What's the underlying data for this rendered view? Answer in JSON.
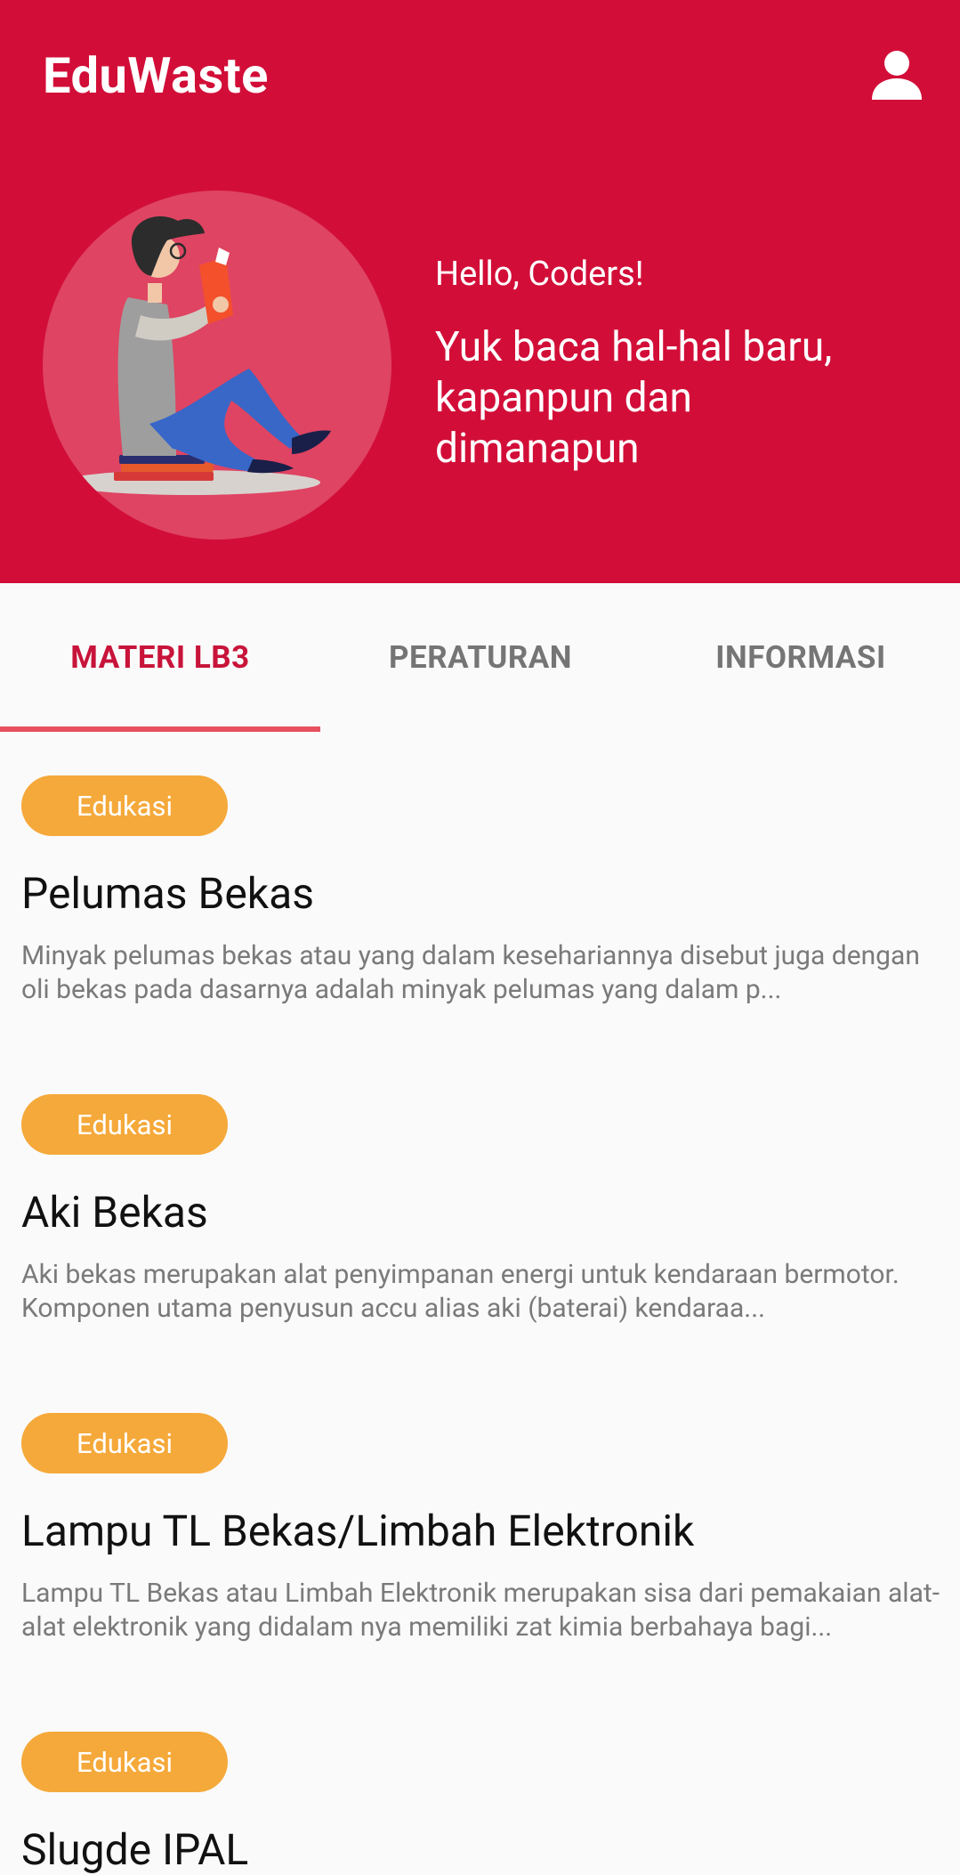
{
  "app": {
    "title": "EduWaste"
  },
  "hero": {
    "greeting": "Hello, Coders!",
    "tagline": "Yuk baca hal-hal baru, kapanpun dan dimanapun"
  },
  "tabs": [
    {
      "label": "MATERI LB3",
      "active": true
    },
    {
      "label": "PERATURAN",
      "active": false
    },
    {
      "label": "INFORMASI",
      "active": false
    }
  ],
  "articles": [
    {
      "badge": "Edukasi",
      "title": "Pelumas Bekas",
      "desc": "Minyak pelumas bekas atau yang dalam kesehariannya disebut juga dengan oli bekas pada dasarnya adalah minyak pelumas yang dalam p..."
    },
    {
      "badge": "Edukasi",
      "title": "Aki Bekas",
      "desc": "Aki bekas merupakan alat penyimpanan energi untuk kendaraan bermotor. Komponen utama penyusun accu alias aki (baterai) kendaraa..."
    },
    {
      "badge": "Edukasi",
      "title": "Lampu TL Bekas/Limbah Elektronik",
      "desc": "Lampu TL Bekas atau Limbah Elektronik merupakan sisa dari pemakaian alat-alat elektronik yang didalam nya memiliki zat kimia berbahaya bagi..."
    },
    {
      "badge": "Edukasi",
      "title": "Slugde IPAL",
      "desc": ""
    }
  ],
  "colors": {
    "primary": "#d20e38",
    "badge": "#f5a93a",
    "tab_active": "#c8143a",
    "indicator": "#e8505f"
  },
  "icons": {
    "profile": "person-icon",
    "hero": "reading-person-illustration"
  }
}
